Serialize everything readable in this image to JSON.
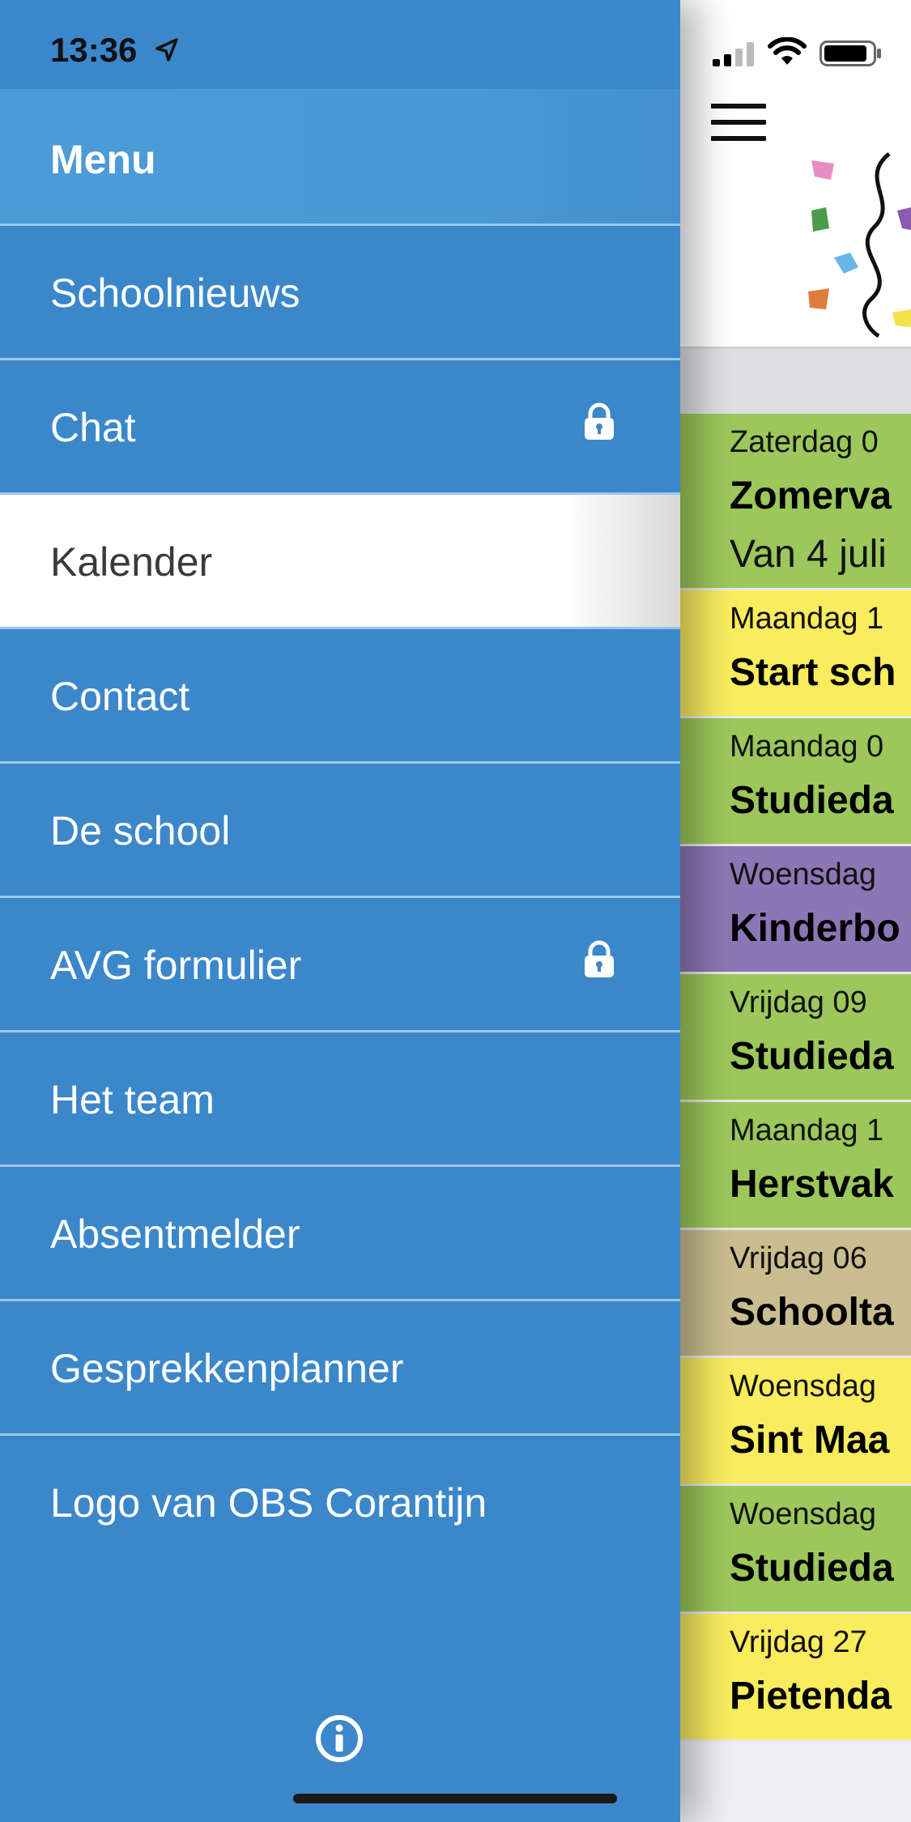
{
  "status_bar": {
    "time": "13:36"
  },
  "drawer": {
    "title": "Menu",
    "items": [
      {
        "label": "Schoolnieuws",
        "locked": false,
        "active": false
      },
      {
        "label": "Chat",
        "locked": true,
        "active": false
      },
      {
        "label": "Kalender",
        "locked": false,
        "active": true
      },
      {
        "label": "Contact",
        "locked": false,
        "active": false
      },
      {
        "label": "De school",
        "locked": false,
        "active": false
      },
      {
        "label": "AVG formulier",
        "locked": true,
        "active": false
      },
      {
        "label": "Het team",
        "locked": false,
        "active": false
      },
      {
        "label": "Absentmelder",
        "locked": false,
        "active": false
      },
      {
        "label": "Gesprekkenplanner",
        "locked": false,
        "active": false
      },
      {
        "label": "Logo van OBS Corantijn",
        "locked": false,
        "active": false
      }
    ]
  },
  "calendar": {
    "events": [
      {
        "date": "Zaterdag 0",
        "title": "Zomerva",
        "desc": "Van 4 juli",
        "color": "#9cc75a"
      },
      {
        "date": "Maandag 1",
        "title": "Start sch",
        "desc": "",
        "color": "#f9ec5d"
      },
      {
        "date": "Maandag 0",
        "title": "Studieda",
        "desc": "",
        "color": "#9cc75a"
      },
      {
        "date": "Woensdag",
        "title": "Kinderbo",
        "desc": "",
        "color": "#8d76b5"
      },
      {
        "date": "Vrijdag 09",
        "title": "Studieda",
        "desc": "",
        "color": "#9cc75a"
      },
      {
        "date": "Maandag 1",
        "title": "Herstvak",
        "desc": "",
        "color": "#9cc75a"
      },
      {
        "date": "Vrijdag 06",
        "title": "Schoolta",
        "desc": "",
        "color": "#c9bd8f"
      },
      {
        "date": "Woensdag",
        "title": "Sint Maa",
        "desc": "",
        "color": "#f9ec5d"
      },
      {
        "date": "Woensdag",
        "title": "Studieda",
        "desc": "",
        "color": "#9cc75a"
      },
      {
        "date": "Vrijdag 27",
        "title": "Pietenda",
        "desc": "",
        "color": "#f9ec5d"
      }
    ]
  },
  "icons": {
    "hamburger": "menu-icon",
    "lock": "lock-icon",
    "info": "info-icon",
    "location": "location-arrow-icon"
  }
}
